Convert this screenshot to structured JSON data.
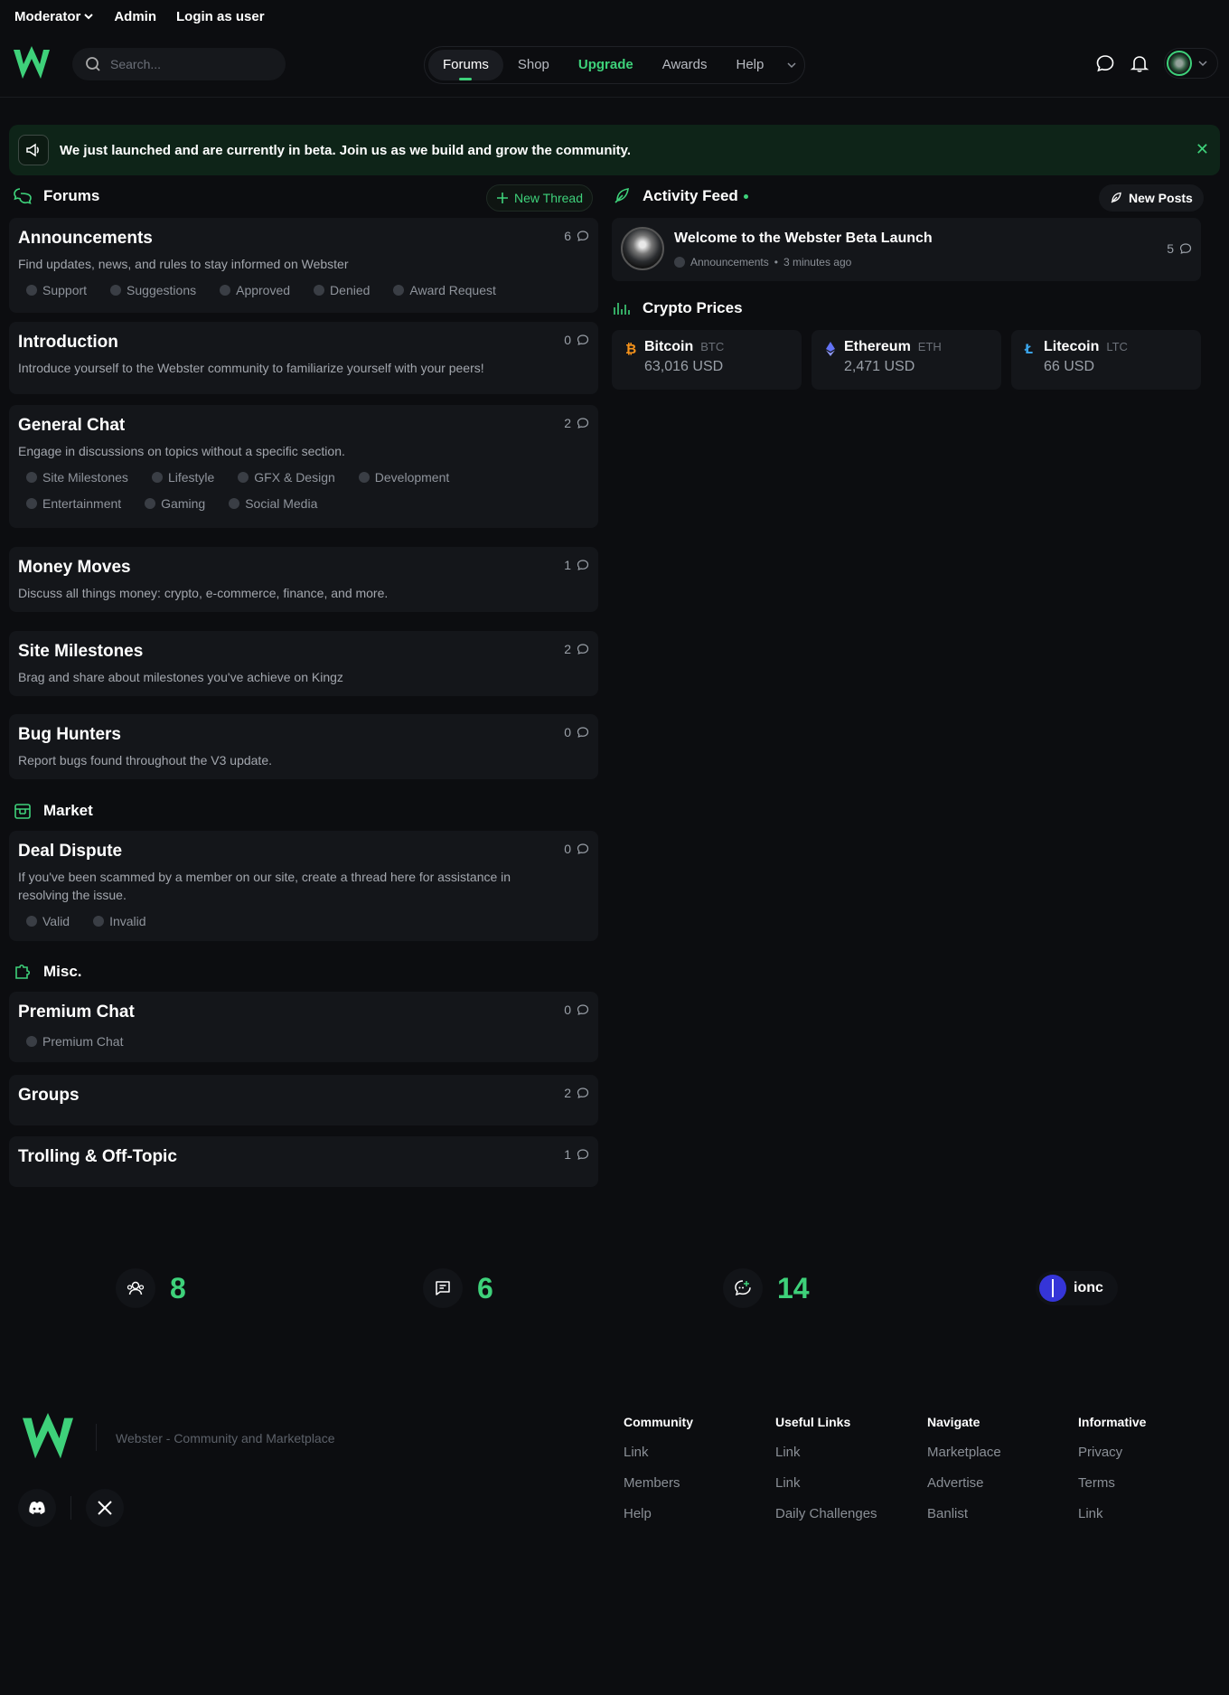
{
  "topbar": {
    "moderator": "Moderator",
    "admin": "Admin",
    "login_as_user": "Login as user"
  },
  "search": {
    "placeholder": "Search..."
  },
  "nav": {
    "forums": "Forums",
    "shop": "Shop",
    "upgrade": "Upgrade",
    "awards": "Awards",
    "help": "Help"
  },
  "banner": {
    "text": "We just launched and are currently in beta. Join us as we build and grow the community."
  },
  "forums": {
    "heading": "Forums",
    "new_thread": "New Thread",
    "cards": [
      {
        "title": "Announcements",
        "desc": "Find updates, news, and rules to stay informed on Webster",
        "count": "6",
        "tags": [
          "Support",
          "Suggestions",
          "Approved",
          "Denied",
          "Award Request"
        ]
      },
      {
        "title": "Introduction",
        "desc": "Introduce yourself to the Webster community to familiarize yourself with your peers!",
        "count": "0"
      },
      {
        "title": "General Chat",
        "desc": "Engage in discussions on topics without a specific section.",
        "count": "2",
        "tags": [
          "Site Milestones",
          "Lifestyle",
          "GFX & Design",
          "Development",
          "Entertainment",
          "Gaming",
          "Social Media"
        ]
      },
      {
        "title": "Money Moves",
        "desc": "Discuss all things money: crypto, e-commerce, finance, and more.",
        "count": "1"
      },
      {
        "title": "Site Milestones",
        "desc": "Brag and share about milestones you've achieve on Kingz",
        "count": "2"
      },
      {
        "title": "Bug Hunters",
        "desc": "Report bugs found throughout the V3 update.",
        "count": "0"
      }
    ]
  },
  "market": {
    "heading": "Market",
    "cards": [
      {
        "title": "Deal Dispute",
        "desc": "If you've been scammed by a member on our site, create a thread here for assistance in resolving the issue.",
        "count": "0",
        "tags": [
          "Valid",
          "Invalid"
        ]
      }
    ]
  },
  "misc": {
    "heading": "Misc.",
    "cards": [
      {
        "title": "Premium Chat",
        "count": "0",
        "tags": [
          "Premium Chat"
        ]
      },
      {
        "title": "Groups",
        "count": "2"
      },
      {
        "title": "Trolling & Off-Topic",
        "count": "1"
      }
    ]
  },
  "feed": {
    "heading": "Activity Feed",
    "new_posts": "New Posts",
    "item": {
      "title": "Welcome to the Webster Beta Launch",
      "category": "Announcements",
      "time": "3 minutes ago",
      "count": "5"
    }
  },
  "crypto": {
    "heading": "Crypto Prices",
    "coins": [
      {
        "name": "Bitcoin",
        "symbol": "BTC",
        "price": "63,016 USD",
        "color": "#f7931a",
        "icon": "bitcoin-icon"
      },
      {
        "name": "Ethereum",
        "symbol": "ETH",
        "price": "2,471 USD",
        "color": "#6272f5",
        "icon": "ethereum-icon"
      },
      {
        "name": "Litecoin",
        "symbol": "LTC",
        "price": "66 USD",
        "color": "#3aa3e8",
        "icon": "litecoin-icon"
      }
    ]
  },
  "stats": {
    "members": "8",
    "threads": "6",
    "posts": "14",
    "newest_member": "ionc"
  },
  "footer": {
    "tagline": "Webster - Community and Marketplace",
    "columns": [
      {
        "heading": "Community",
        "links": [
          "Link",
          "Members",
          "Help"
        ]
      },
      {
        "heading": "Useful Links",
        "links": [
          "Link",
          "Link",
          "Daily Challenges"
        ]
      },
      {
        "heading": "Navigate",
        "links": [
          "Marketplace",
          "Advertise",
          "Banlist"
        ]
      },
      {
        "heading": "Informative",
        "links": [
          "Privacy",
          "Terms",
          "Link"
        ]
      }
    ]
  },
  "colors": {
    "accent": "#3ed17a",
    "background": "#0c0d10",
    "card": "#14161a"
  }
}
